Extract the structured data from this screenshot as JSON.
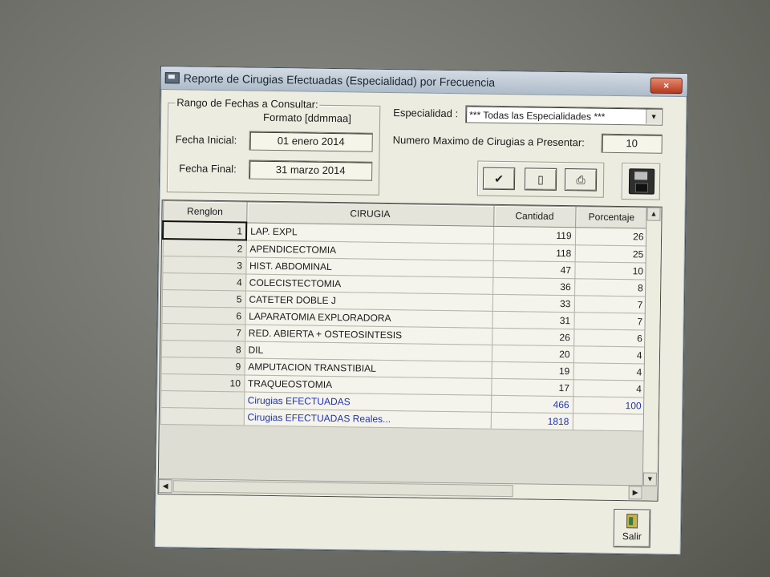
{
  "window": {
    "title": "Reporte de Cirugias Efectuadas (Especialidad) por Frecuencia",
    "close_label": "×"
  },
  "date_range": {
    "legend": "Rango de Fechas a Consultar:",
    "format_label": "Formato [ddmmaa]",
    "start_label": "Fecha Inicial:",
    "start_value": "01 enero 2014",
    "end_label": "Fecha Final:",
    "end_value": "31 marzo 2014"
  },
  "specialty": {
    "label": "Especialidad :",
    "value": "*** Todas las Especialidades ***"
  },
  "max_surgeries": {
    "label": "Numero Maximo de Cirugias a Presentar:",
    "value": "10"
  },
  "grid": {
    "columns": [
      "Renglon",
      "CIRUGIA",
      "Cantidad",
      "Porcentaje"
    ],
    "rows": [
      {
        "row": "1",
        "surgery": "LAP. EXPL",
        "qty": "119",
        "pct": "26"
      },
      {
        "row": "2",
        "surgery": "APENDICECTOMIA",
        "qty": "118",
        "pct": "25"
      },
      {
        "row": "3",
        "surgery": "HIST. ABDOMINAL",
        "qty": "47",
        "pct": "10"
      },
      {
        "row": "4",
        "surgery": "COLECISTECTOMIA",
        "qty": "36",
        "pct": "8"
      },
      {
        "row": "5",
        "surgery": "CATETER DOBLE J",
        "qty": "33",
        "pct": "7"
      },
      {
        "row": "6",
        "surgery": "LAPARATOMIA EXPLORADORA",
        "qty": "31",
        "pct": "7"
      },
      {
        "row": "7",
        "surgery": "RED. ABIERTA + OSTEOSINTESIS",
        "qty": "26",
        "pct": "6"
      },
      {
        "row": "8",
        "surgery": "DIL",
        "qty": "20",
        "pct": "4"
      },
      {
        "row": "9",
        "surgery": "AMPUTACION TRANSTIBIAL",
        "qty": "19",
        "pct": "4"
      },
      {
        "row": "10",
        "surgery": "TRAQUEOSTOMIA",
        "qty": "17",
        "pct": "4"
      }
    ],
    "summary": [
      {
        "label": "Cirugias EFECTUADAS",
        "qty": "466",
        "pct": "100"
      },
      {
        "label": "Cirugias EFECTUADAS Reales...",
        "qty": "1818",
        "pct": ""
      }
    ]
  },
  "buttons": {
    "exit_label": "Salir"
  },
  "chart_data": {
    "type": "table",
    "columns": [
      "Renglon",
      "CIRUGIA",
      "Cantidad",
      "Porcentaje"
    ],
    "rows": [
      [
        1,
        "LAP. EXPL",
        119,
        26
      ],
      [
        2,
        "APENDICECTOMIA",
        118,
        25
      ],
      [
        3,
        "HIST. ABDOMINAL",
        47,
        10
      ],
      [
        4,
        "COLECISTECTOMIA",
        36,
        8
      ],
      [
        5,
        "CATETER DOBLE J",
        33,
        7
      ],
      [
        6,
        "LAPARATOMIA EXPLORADORA",
        31,
        7
      ],
      [
        7,
        "RED. ABIERTA + OSTEOSINTESIS",
        26,
        6
      ],
      [
        8,
        "DIL",
        20,
        4
      ],
      [
        9,
        "AMPUTACION TRANSTIBIAL",
        19,
        4
      ],
      [
        10,
        "TRAQUEOSTOMIA",
        17,
        4
      ]
    ],
    "totals": [
      [
        "",
        "Cirugias EFECTUADAS",
        466,
        100
      ],
      [
        "",
        "Cirugias EFECTUADAS Reales...",
        1818,
        null
      ]
    ]
  }
}
